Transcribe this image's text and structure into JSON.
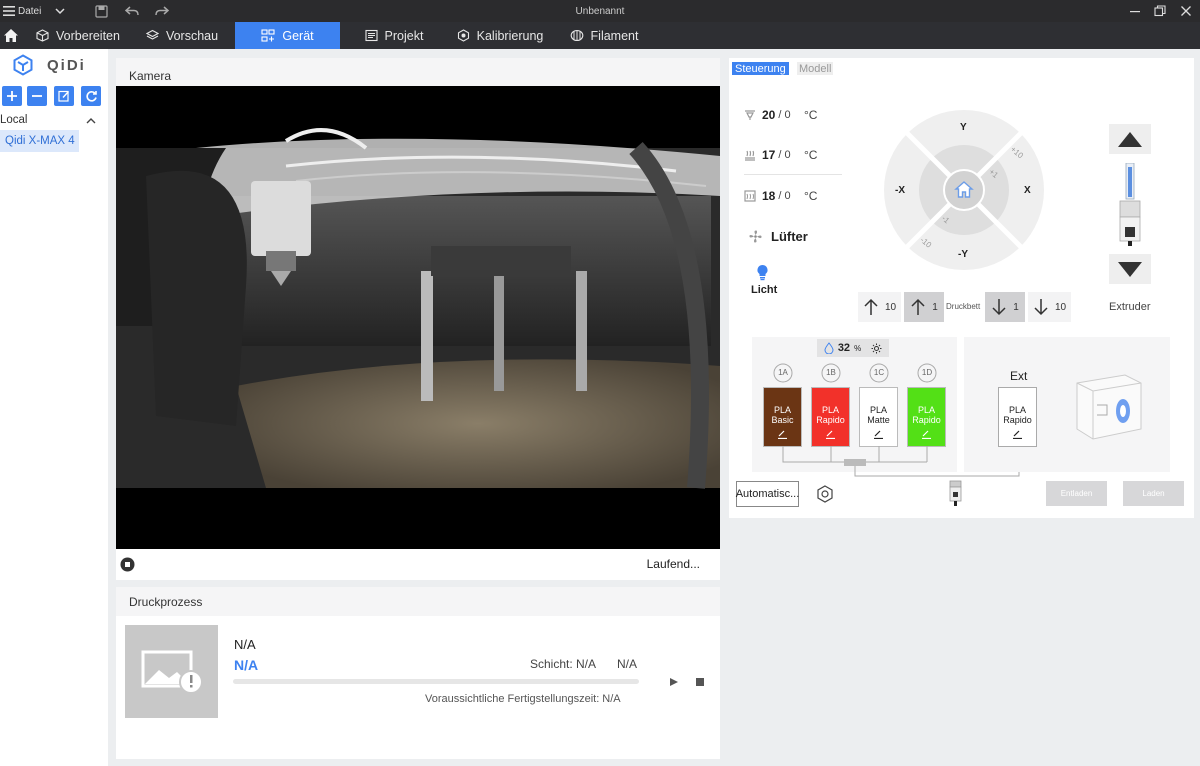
{
  "titlebar": {
    "menu_label": "Datei",
    "window_title": "Unbenannt"
  },
  "nav": {
    "tabs": [
      {
        "label": "Vorbereiten",
        "icon": "cube-icon"
      },
      {
        "label": "Vorschau",
        "icon": "layers-icon"
      },
      {
        "label": "Gerät",
        "icon": "device-icon",
        "active": true
      },
      {
        "label": "Projekt",
        "icon": "project-icon"
      },
      {
        "label": "Kalibrierung",
        "icon": "calibration-icon"
      },
      {
        "label": "Filament",
        "icon": "filament-icon"
      }
    ]
  },
  "sidebar": {
    "logo_text": "QiDi",
    "section_label": "Local",
    "printer_name": "Qidi X-MAX 4"
  },
  "camera": {
    "title": "Kamera",
    "status": "Laufend..."
  },
  "print_job": {
    "title": "Druckprozess",
    "file_name": "N/A",
    "task_name": "N/A",
    "layer_label": "Schicht: N/A",
    "progress_value": "N/A",
    "eta_label": "Voraussichtliche Fertigstellungszeit: N/A",
    "progress": 0
  },
  "control": {
    "tab_control": "Steuerung",
    "tab_model": "Modell",
    "temps": [
      {
        "value": "20",
        "target": "/ 0",
        "unit": "°C"
      },
      {
        "value": "17",
        "target": "/ 0",
        "unit": "°C"
      },
      {
        "value": "18",
        "target": "/ 0",
        "unit": "°C"
      }
    ],
    "fan_label": "Lüfter",
    "light_label": "Licht",
    "axis": {
      "y_plus": "Y",
      "y_minus": "-Y",
      "x_plus": "X",
      "x_minus": "-X",
      "plus10": "+10",
      "plus1": "+1",
      "minus1": "-1",
      "minus10": "-10"
    },
    "bed_label": "Druckbett",
    "bed_steps": [
      "10",
      "1",
      "1",
      "10"
    ],
    "extruder_label": "Extruder"
  },
  "ams": {
    "humidity": "32",
    "humidity_unit": "%",
    "slots": [
      {
        "id": "1A",
        "line1": "PLA",
        "line2": "Basic",
        "color": "#6b3514",
        "text_color": "#ffffff"
      },
      {
        "id": "1B",
        "line1": "PLA",
        "line2": "Rapido",
        "color": "#f2312a",
        "text_color": "#ffffff"
      },
      {
        "id": "1C",
        "line1": "PLA",
        "line2": "Matte",
        "color": "#ffffff",
        "text_color": "#222222"
      },
      {
        "id": "1D",
        "line1": "PLA",
        "line2": "Rapido",
        "color": "#53e016",
        "text_color": "#ffffff"
      }
    ],
    "ext_label": "Ext",
    "ext_line1": "PLA",
    "ext_line2": "Rapido",
    "auto_button": "Automatisc...",
    "unload_button": "Entladen",
    "load_button": "Laden"
  },
  "colors": {
    "accent": "#3d82f0",
    "nav_bg": "#2e2f33",
    "titlebar_bg": "#2b2b2d"
  }
}
